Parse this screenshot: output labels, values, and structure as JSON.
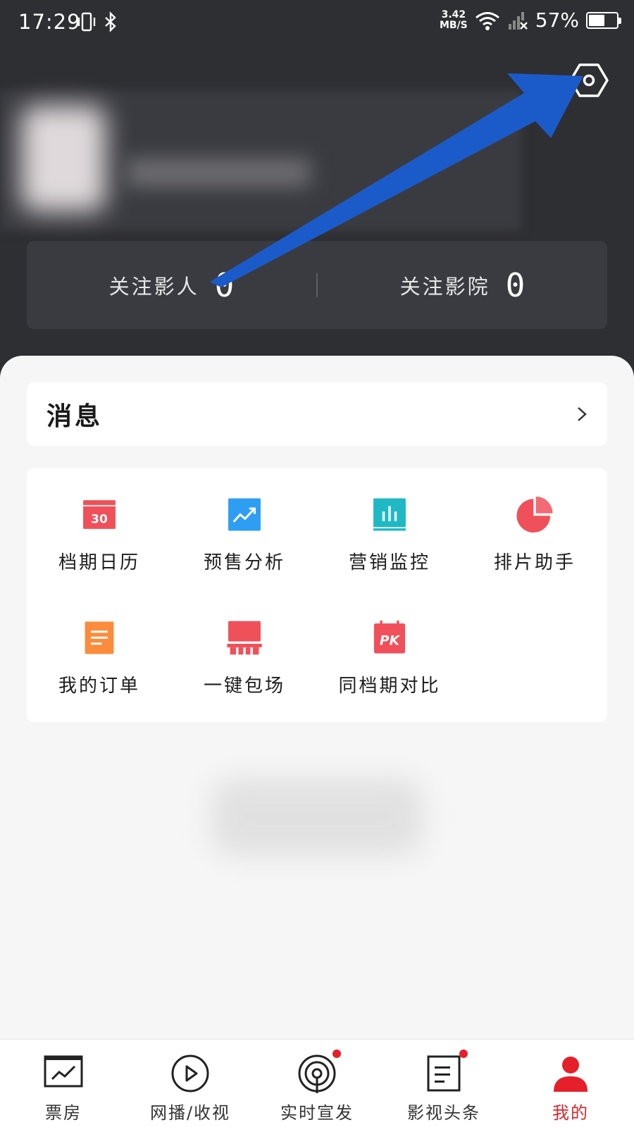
{
  "status_bar": {
    "time": "17:29",
    "net_speed_value": "3.42",
    "net_speed_unit": "MB/S",
    "battery_percent": "57%",
    "battery_level": 0.57
  },
  "follow": {
    "people_label": "关注影人",
    "people_count": "0",
    "cinemas_label": "关注影院",
    "cinemas_count": "0"
  },
  "messages": {
    "title": "消息"
  },
  "tools": [
    {
      "label": "档期日历",
      "icon": "calendar-icon",
      "badge": "30",
      "color": "#f0505a"
    },
    {
      "label": "预售分析",
      "icon": "trend-chart-icon",
      "color": "#2e9ef2"
    },
    {
      "label": "营销监控",
      "icon": "bar-chart-icon",
      "color": "#1fb9c4"
    },
    {
      "label": "排片助手",
      "icon": "pie-chart-icon",
      "color": "#f0505a"
    },
    {
      "label": "我的订单",
      "icon": "document-icon",
      "color": "#fb8c3c"
    },
    {
      "label": "一键包场",
      "icon": "cinema-seats-icon",
      "color": "#f0505a"
    },
    {
      "label": "同档期对比",
      "icon": "pk-calendar-icon",
      "badge": "PK",
      "color": "#f0505a"
    }
  ],
  "bottom_nav": [
    {
      "label": "票房",
      "icon": "box-office-icon"
    },
    {
      "label": "网播/收视",
      "icon": "play-icon"
    },
    {
      "label": "实时宣发",
      "icon": "broadcast-icon",
      "dot": true
    },
    {
      "label": "影视头条",
      "icon": "news-icon",
      "dot": true
    },
    {
      "label": "我的",
      "icon": "user-icon",
      "active": true
    }
  ],
  "colors": {
    "header_bg": "#2e2f33",
    "accent_red": "#d8262b",
    "arrow_blue": "#1b5bc9"
  }
}
